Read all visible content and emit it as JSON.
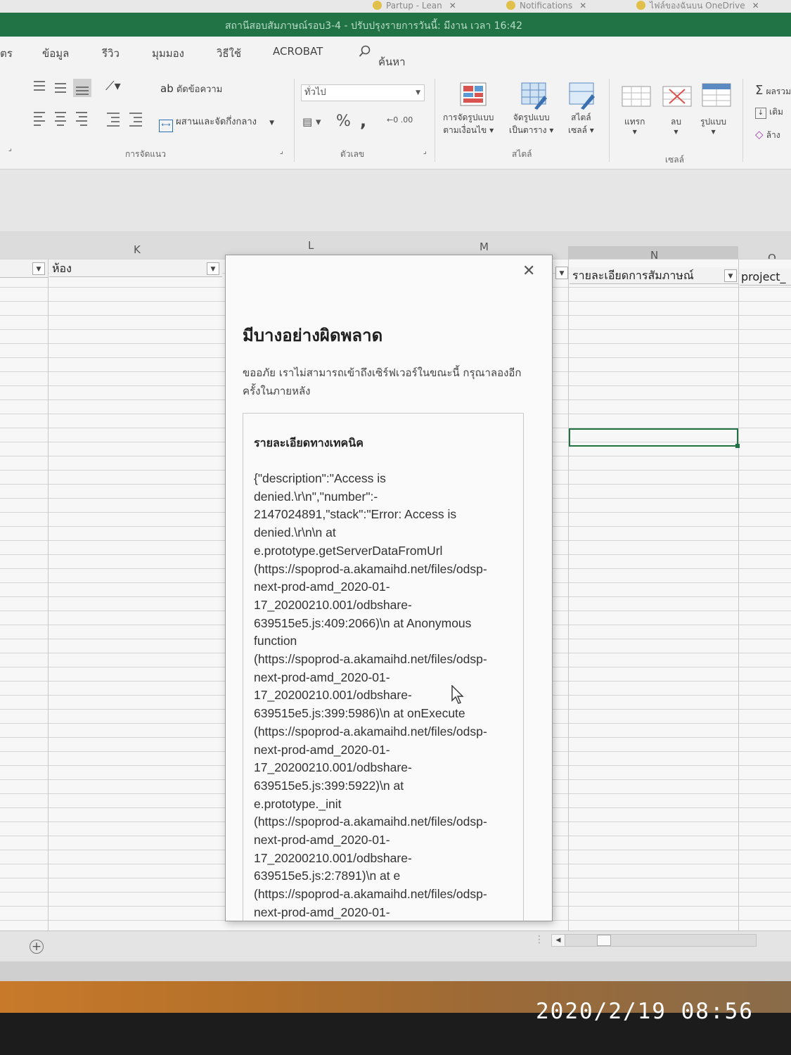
{
  "browser_tabs": [
    {
      "label": "Partup - Lean"
    },
    {
      "label": "Notifications"
    },
    {
      "label": "ไฟล์ของฉันบน OneDrive"
    }
  ],
  "window": {
    "title": "สถานีสอบสัมภาษณ์รอบ3-4 - ปรับปรุงรายการวันนี้: มีงาน เวลา 16:42"
  },
  "ribbon_tabs": [
    "ตร",
    "ข้อมูล",
    "รีวิว",
    "มุมมอง",
    "วิธีใช้",
    "ACROBAT",
    "ค้นหา"
  ],
  "ribbon": {
    "wrap_text": "ตัดข้อความ",
    "merge_center": "ผสานและจัดกึ่งกลาง",
    "number_format": "ทั่วไป",
    "cond_format": [
      "การจัดรูปแบบ",
      "ตามเงื่อนไข"
    ],
    "format_table": [
      "จัดรูปแบบ",
      "เป็นตาราง"
    ],
    "cell_styles": [
      "สไตล์",
      "เซลล์"
    ],
    "insert": "แทรก",
    "delete": "ลบ",
    "format": "รูปแบบ",
    "autosum": "ผลรวม",
    "fill": "เติม",
    "clear": "ล้าง",
    "group_alignment": "การจัดแนว",
    "group_number": "ตัวเลข",
    "group_styles": "สไตล์",
    "group_cells": "เซลล์"
  },
  "columns": [
    "K",
    "L",
    "M",
    "N",
    "O"
  ],
  "header_cells": {
    "k": "ห้อง",
    "n": "รายละเอียดการสัมภาษณ์",
    "o": "project_"
  },
  "dialog": {
    "heading": "มีบางอย่างผิดพลาด",
    "message": "ขออภัย เราไม่สามารถเข้าถึงเซิร์ฟเวอร์ในขณะนี้ กรุณาลองอีกครั้งในภายหลัง",
    "tech_heading": "รายละเอียดทางเทคนิค",
    "tech_text": "{\"description\":\"Access is\ndenied.\\r\\n\",\"number\":-\n2147024891,\"stack\":\"Error: Access is\ndenied.\\r\\n\\n at\ne.prototype.getServerDataFromUrl\n(https://spoprod-a.akamaihd.net/files/odsp-\nnext-prod-amd_2020-01-\n17_20200210.001/odbshare-\n639515e5.js:409:2066)\\n at Anonymous\nfunction\n(https://spoprod-a.akamaihd.net/files/odsp-\nnext-prod-amd_2020-01-\n17_20200210.001/odbshare-\n639515e5.js:399:5986)\\n at onExecute\n(https://spoprod-a.akamaihd.net/files/odsp-\nnext-prod-amd_2020-01-\n17_20200210.001/odbshare-\n639515e5.js:399:5922)\\n at\ne.prototype._init\n(https://spoprod-a.akamaihd.net/files/odsp-\nnext-prod-amd_2020-01-\n17_20200210.001/odbshare-\n639515e5.js:2:7891)\\n at e\n(https://spoprod-a.akamaihd.net/files/odsp-\nnext-prod-amd_2020-01-"
  },
  "timestamp": "2020/2/19  08:56",
  "colors": {
    "excel_green": "#217346",
    "ribbon_bg": "#f3f3f3"
  }
}
